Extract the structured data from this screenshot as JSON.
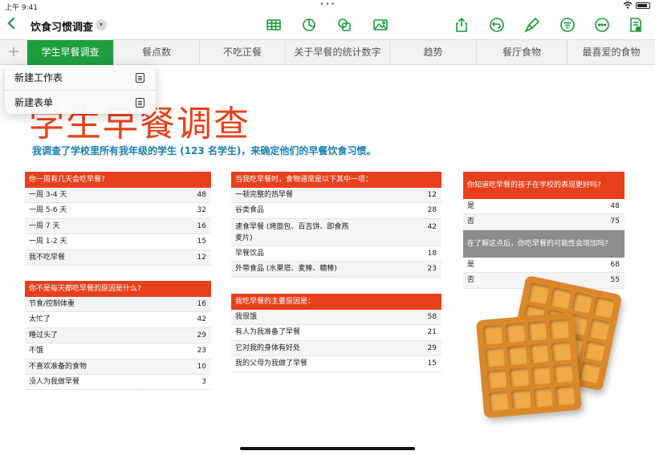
{
  "status": {
    "time": "上午 9:41",
    "dots": "•••"
  },
  "toolbar": {
    "back_icon": "chevron-left-icon",
    "title": "饮食习惯调查",
    "title_menu_icon": "chevron-down-icon",
    "center_icons": [
      "table-icon",
      "chart-icon",
      "shapes-icon",
      "media-icon"
    ],
    "right_icons": [
      "share-icon",
      "undo-icon",
      "format-brush-icon",
      "filter-icon",
      "more-icon",
      "document-setup-icon"
    ],
    "accent": "#1a9a3a"
  },
  "tabs": {
    "add_label": "+",
    "items": [
      "学生早餐调查",
      "餐点数",
      "不吃正餐",
      "关于早餐的统计数字",
      "趋势",
      "餐厅食物",
      "最喜爱的食物"
    ],
    "active_index": 0,
    "active_color": "#1e9e3e"
  },
  "menu": {
    "items": [
      {
        "label": "新建工作表",
        "icon": "sheet-icon"
      },
      {
        "label": "新建表单",
        "icon": "form-icon"
      }
    ]
  },
  "canvas": {
    "title": "学生早餐调查",
    "subtitle": "我调查了学校里所有我年级的学生 (123 名学生)，来确定他们的早餐饮食习惯。",
    "title_color": "#e8401c",
    "subtitle_color": "#1a7fb0"
  },
  "tables": {
    "days": {
      "header": "你一周有几天会吃早餐?",
      "rows": [
        {
          "label": "一周 3-4 天",
          "value": "48"
        },
        {
          "label": "一周 5-6 天",
          "value": "32"
        },
        {
          "label": "一周 7 天",
          "value": "16"
        },
        {
          "label": "一周 1-2 天",
          "value": "15"
        },
        {
          "label": "我不吃早餐",
          "value": "12"
        }
      ]
    },
    "reasons_not": {
      "header": "你不是每天都吃早餐的原因是什么?",
      "rows": [
        {
          "label": "节食/控制体重",
          "value": "16"
        },
        {
          "label": "太忙了",
          "value": "42"
        },
        {
          "label": "睡过头了",
          "value": "29"
        },
        {
          "label": "不饿",
          "value": "23"
        },
        {
          "label": "不喜欢准备的食物",
          "value": "10"
        },
        {
          "label": "没人为我做早餐",
          "value": "3"
        }
      ]
    },
    "food_type": {
      "header": "当我吃早餐时，食物通常是以下其中一项：",
      "rows": [
        {
          "label": "一顿完整的热早餐",
          "value": "12"
        },
        {
          "label": "谷类食品",
          "value": "28"
        },
        {
          "label": "速食早餐 (烤面包、百吉饼、即食燕麦片)",
          "value": "42"
        },
        {
          "label": "早餐饮品",
          "value": "18"
        },
        {
          "label": "外带食品 (水果塔、麦棒、糖棒)",
          "value": "23"
        }
      ]
    },
    "main_reason": {
      "header": "我吃早餐的主要原因是：",
      "rows": [
        {
          "label": "我很饿",
          "value": "58"
        },
        {
          "label": "有人为我准备了早餐",
          "value": "21"
        },
        {
          "label": "它对我的身体有好处",
          "value": "29"
        },
        {
          "label": "我的父母为我做了早餐",
          "value": "15"
        }
      ]
    },
    "performance": {
      "header": "你知道吃早餐的孩子在学校的表现更好吗?",
      "rows": [
        {
          "label": "是",
          "value": "48"
        },
        {
          "label": "否",
          "value": "75"
        }
      ],
      "header2": "在了解这点后，你吃早餐的可能性会增加吗?",
      "rows2": [
        {
          "label": "是",
          "value": "68"
        },
        {
          "label": "否",
          "value": "55"
        }
      ]
    }
  },
  "image": {
    "name": "waffles-image"
  }
}
